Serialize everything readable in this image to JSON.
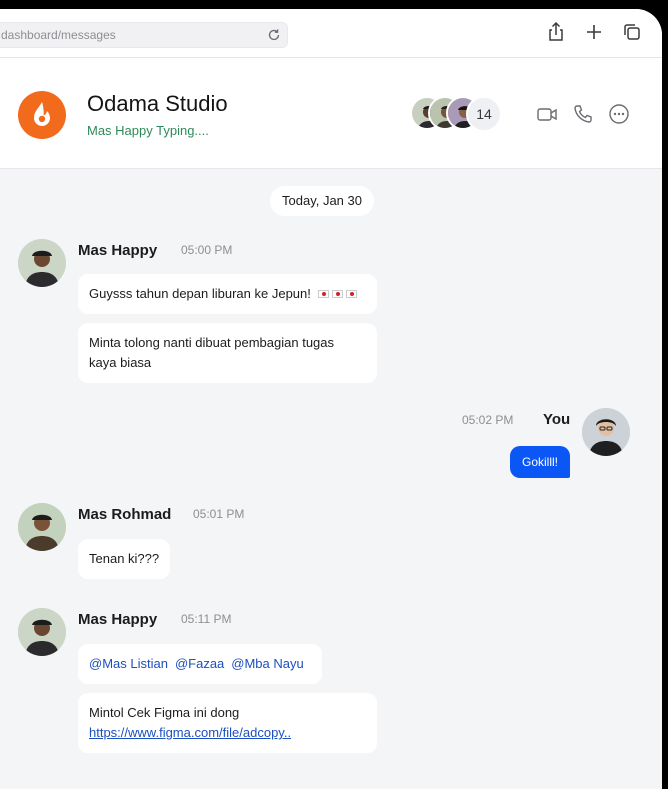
{
  "browser": {
    "url": "dashboard/messages",
    "icons": [
      "reload-icon",
      "share-icon",
      "plus-icon",
      "tabs-icon"
    ]
  },
  "header": {
    "group_name": "Odama Studio",
    "status": "Mas Happy Typing....",
    "member_count": "14",
    "icons": [
      "video-call-icon",
      "phone-icon",
      "more-icon"
    ],
    "logo_color": "#f26a1b"
  },
  "chat": {
    "date": "Today, Jan 30",
    "messages": [
      {
        "sender": "Mas Happy",
        "time": "05:00 PM",
        "bubbles": [
          "Guysss tahun depan liburan ke Jepun!",
          "Minta tolong nanti dibuat pembagian tugas",
          "kaya biasa"
        ]
      },
      {
        "sender": "You",
        "time": "05:02 PM",
        "bubbles": [
          "Gokilll!"
        ]
      },
      {
        "sender": "Mas Rohmad",
        "time": "05:01 PM",
        "bubbles": [
          "Tenan ki???"
        ]
      },
      {
        "sender": "Mas Happy",
        "time": "05:11 PM",
        "mentions": [
          "@Mas Listian",
          "@Fazaa",
          "@Mba Nayu"
        ],
        "bubbles": [
          "Mintol Cek Figma ini dong",
          "https://www.figma.com/file/adcopy.."
        ]
      }
    ]
  },
  "colors": {
    "accent": "#0a57f5",
    "typing": "#2f8a5a",
    "link": "#1d4fbf",
    "background": "#f4f5f7"
  }
}
